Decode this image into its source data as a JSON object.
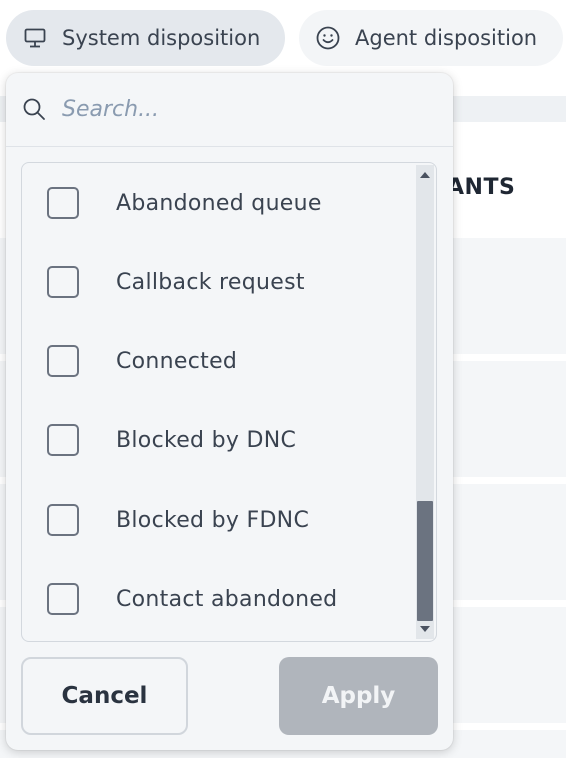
{
  "filters": {
    "system_disposition": {
      "label": "System disposition",
      "icon": "monitor-icon"
    },
    "agent_disposition": {
      "label": "Agent disposition",
      "icon": "smiley-icon"
    }
  },
  "table": {
    "partial_column_header": "ANTS"
  },
  "dropdown": {
    "search": {
      "placeholder": "Search...",
      "value": "",
      "icon": "search-icon"
    },
    "options": [
      {
        "label": "Abandoned queue",
        "checked": false
      },
      {
        "label": "Callback request",
        "checked": false
      },
      {
        "label": "Connected",
        "checked": false
      },
      {
        "label": "Blocked by DNC",
        "checked": false
      },
      {
        "label": "Blocked by FDNC",
        "checked": false
      },
      {
        "label": "Contact abandoned",
        "checked": false
      }
    ],
    "cancel_label": "Cancel",
    "apply_label": "Apply"
  },
  "colors": {
    "chip_active": "#e4e8ed",
    "panel_bg": "#f4f6f8",
    "checkbox_border": "#6b7380",
    "apply_disabled": "#b0b5bc"
  }
}
